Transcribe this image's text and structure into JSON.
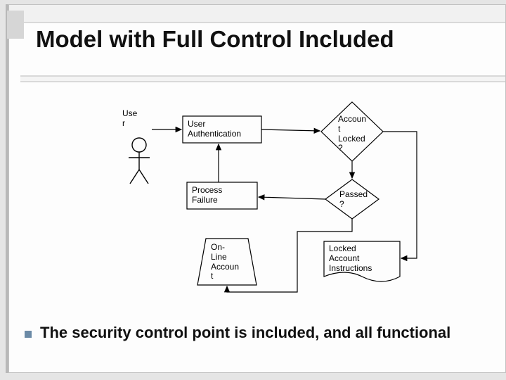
{
  "title": "Model with Full Control Included",
  "actor": {
    "label": "Use\nr"
  },
  "nodes": {
    "user_auth": "User\nAuthentication",
    "account_locked": "Accoun\nt\nLocked\n?",
    "process_failure": "Process\nFailure",
    "passed": "Passed\n?",
    "online_account": "On-\nLine\nAccoun\nt",
    "locked_instructions": "Locked\nAccount\nInstructions"
  },
  "bullet": "The security control point is included, and all functional"
}
